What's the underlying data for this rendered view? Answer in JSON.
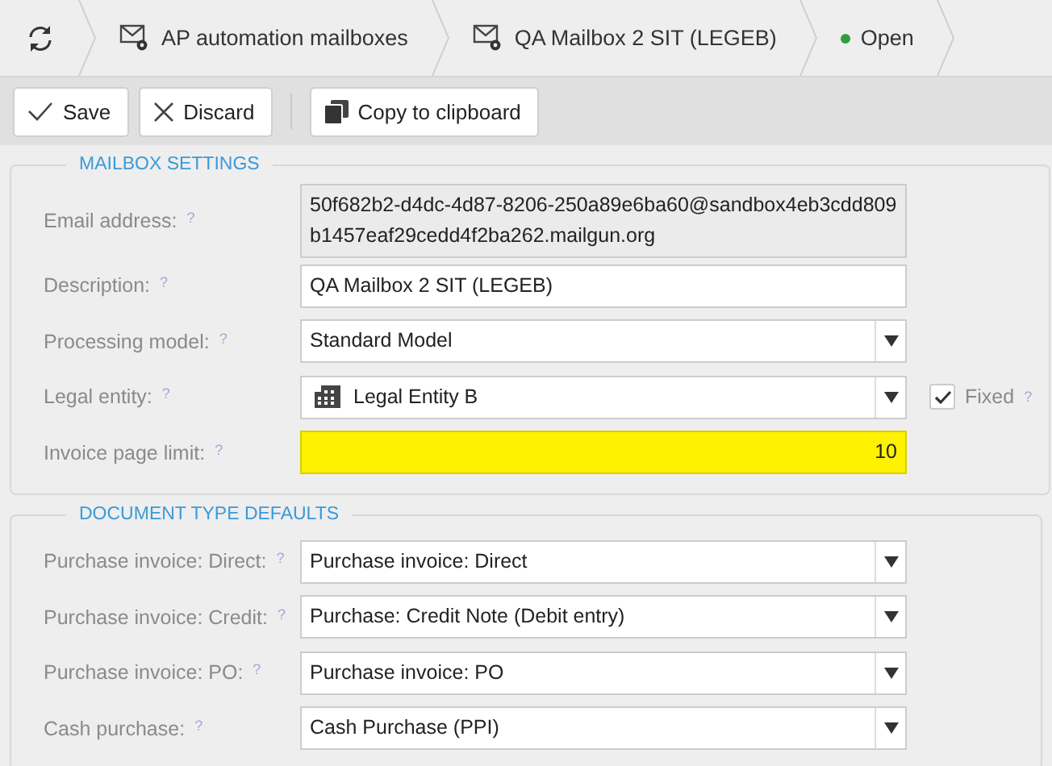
{
  "breadcrumbs": [
    {
      "kind": "refresh"
    },
    {
      "kind": "mailbox",
      "label": "AP automation mailboxes"
    },
    {
      "kind": "mailbox",
      "label": "QA Mailbox 2 SIT (LEGEB)"
    },
    {
      "kind": "status",
      "label": "Open",
      "color": "#2e9e3a"
    }
  ],
  "toolbar": [
    {
      "kind": "save",
      "label": "Save"
    },
    {
      "kind": "discard",
      "label": "Discard"
    },
    {
      "kind": "copy",
      "label": "Copy to clipboard"
    }
  ],
  "sections": [
    {
      "title": "MAILBOX SETTINGS",
      "fields": [
        {
          "label": "Email address:",
          "help": "?",
          "kind": "readonly",
          "value": "50f682b2-d4dc-4d87-8206-250a89e6ba60@sandbox4eb3cdd809b1457eaf29cedd4f2ba262.mailgun.org"
        },
        {
          "label": "Description:",
          "help": "?",
          "kind": "text",
          "value": "QA Mailbox 2 SIT (LEGEB)"
        },
        {
          "label": "Processing model:",
          "help": "?",
          "kind": "select",
          "value": "Standard Model"
        },
        {
          "label": "Legal entity:",
          "help": "?",
          "kind": "entity",
          "value": "Legal Entity B",
          "fixed": {
            "label": "Fixed",
            "checked": true,
            "help": "?"
          }
        },
        {
          "label": "Invoice page limit:",
          "help": "?",
          "kind": "number",
          "value": "10",
          "highlighted": true
        }
      ]
    },
    {
      "title": "DOCUMENT TYPE DEFAULTS",
      "fields": [
        {
          "label": "Purchase invoice: Direct:",
          "help": "?",
          "kind": "select",
          "value": "Purchase invoice: Direct"
        },
        {
          "label": "Purchase invoice: Credit:",
          "help": "?",
          "kind": "select",
          "value": "Purchase: Credit Note (Debit entry)"
        },
        {
          "label": "Purchase invoice: PO:",
          "help": "?",
          "kind": "select",
          "value": "Purchase invoice: PO"
        },
        {
          "label": "Cash purchase:",
          "help": "?",
          "kind": "select",
          "value": "Cash Purchase (PPI)"
        }
      ]
    }
  ]
}
